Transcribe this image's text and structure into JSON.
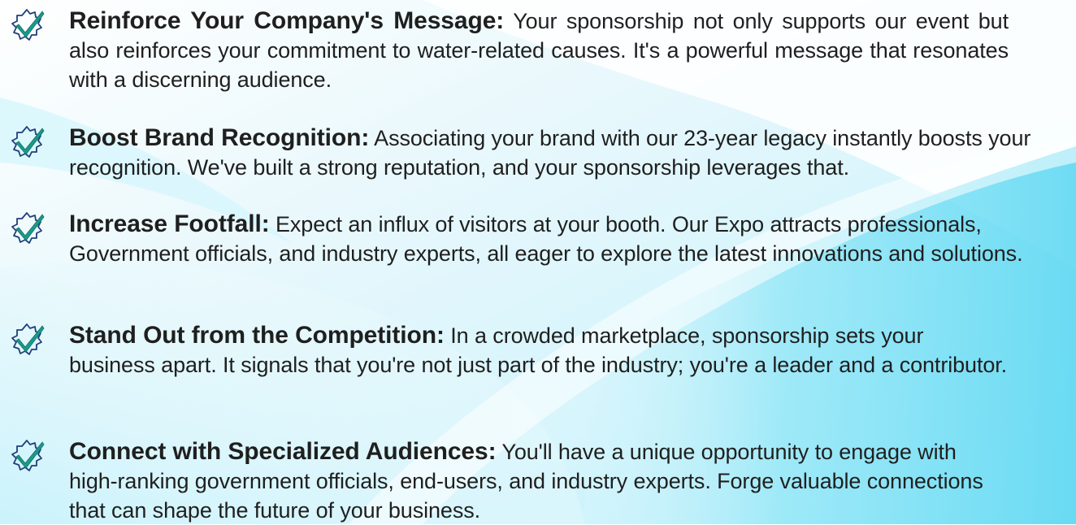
{
  "colors": {
    "icon_teal": "#1a9a8a",
    "icon_outline": "#1f3f7a",
    "text": "#1f1f1f",
    "background_accent": "#7fe3f5"
  },
  "items": [
    {
      "icon": "checkmark-badge-icon",
      "heading": "Reinforce Your Company's Message:",
      "body": " Your sponsorship not only supports our event but also reinforces your commitment to water-related causes. It's a powerful message that resonates with a discerning audience."
    },
    {
      "icon": "checkmark-badge-icon",
      "heading": "Boost Brand Recognition:",
      "body": " Associating your brand with our 23-year legacy instantly boosts your recognition. We've built a strong reputation, and your sponsorship leverages that."
    },
    {
      "icon": "checkmark-badge-icon",
      "heading": "Increase Footfall:",
      "body": " Expect an influx of visitors at your booth. Our Expo attracts professionals, Government officials, and industry experts, all eager to explore the latest innovations and solutions."
    },
    {
      "icon": "checkmark-badge-icon",
      "heading": "Stand Out from the Competition:",
      "body": " In a crowded marketplace, sponsorship sets your business apart. It signals that you're not just part of the industry; you're a leader and a contributor."
    },
    {
      "icon": "checkmark-badge-icon",
      "heading": "Connect with Specialized Audiences:",
      "body": " You'll have a unique opportunity to engage with high-ranking government officials, end-users, and industry experts. Forge valuable connections that can shape the future of your business."
    }
  ]
}
